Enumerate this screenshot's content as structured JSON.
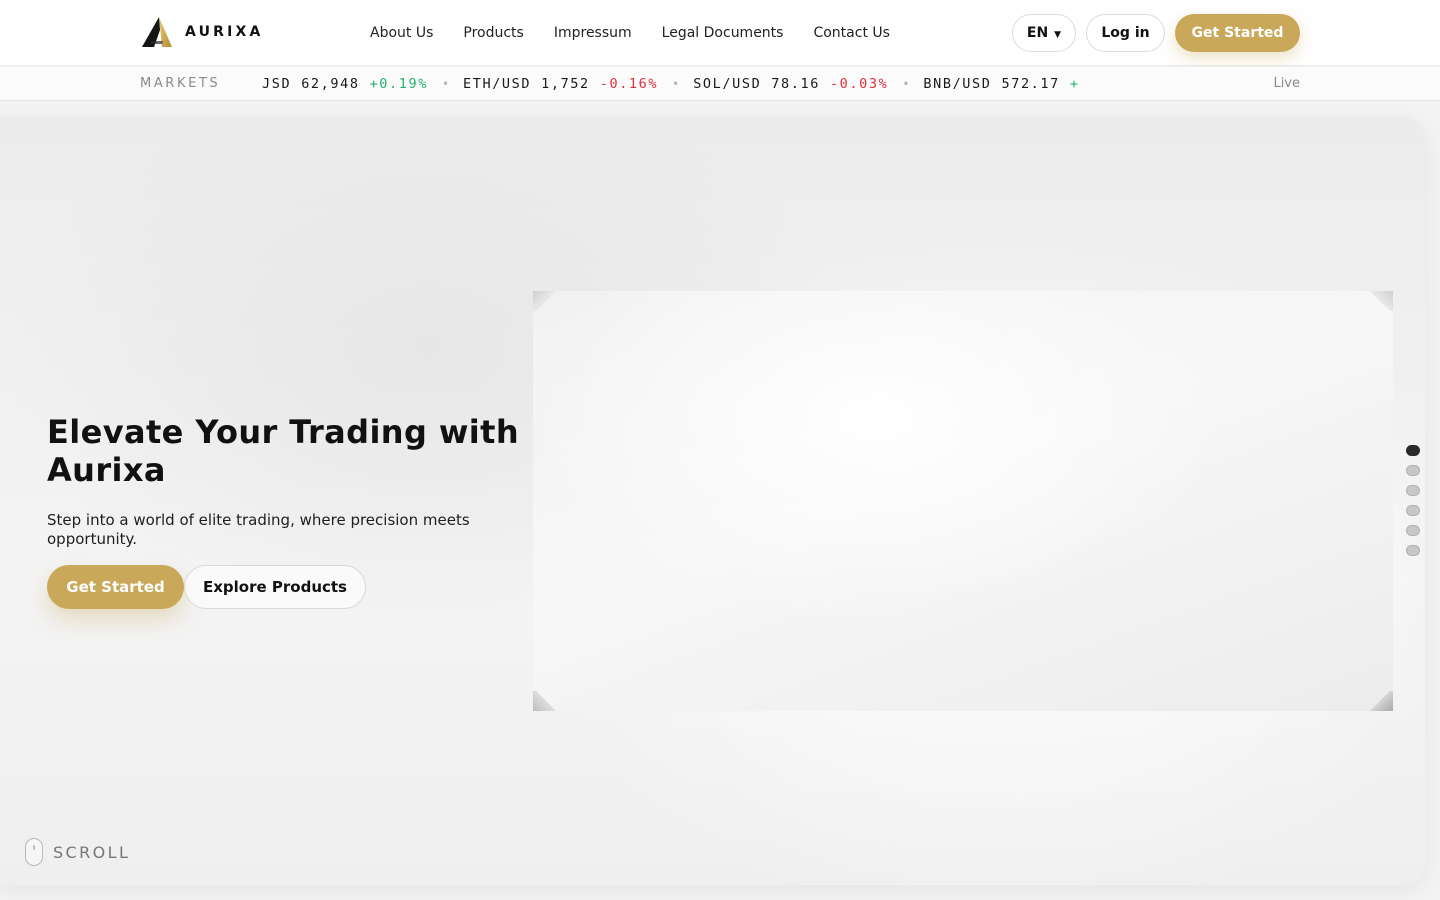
{
  "brand": {
    "name": "AURIXA",
    "colors": {
      "accent": "#c9a85a",
      "up": "#23b26d",
      "down": "#e0303a"
    }
  },
  "nav": {
    "links": [
      {
        "label": "About Us"
      },
      {
        "label": "Products"
      },
      {
        "label": "Impressum"
      },
      {
        "label": "Legal Documents"
      },
      {
        "label": "Contact Us"
      }
    ]
  },
  "header": {
    "language": "EN",
    "language_icon": "caret-down-icon",
    "login_label": "Log in",
    "cta_label": "Get Started"
  },
  "ticker": {
    "label": "MARKETS",
    "live_label": "Live",
    "items": [
      {
        "pair": "JSD",
        "price": "62,948",
        "change": "+0.19%",
        "direction": "up"
      },
      {
        "pair": "ETH/USD",
        "price": "1,752",
        "change": "-0.16%",
        "direction": "down"
      },
      {
        "pair": "SOL/USD",
        "price": "78.16",
        "change": "-0.03%",
        "direction": "down"
      },
      {
        "pair": "BNB/USD",
        "price": "572.17",
        "change": "+",
        "direction": "up"
      }
    ],
    "separator": "•"
  },
  "hero": {
    "title": "Elevate Your Trading with Aurixa",
    "subtitle": "Step into a world of elite trading, where precision meets opportunity.",
    "primary_cta": "Get Started",
    "secondary_cta": "Explore Products",
    "slides": {
      "count": 6,
      "active_index": 0
    },
    "scroll_label": "SCROLL",
    "scroll_icon": "mouse-icon"
  }
}
